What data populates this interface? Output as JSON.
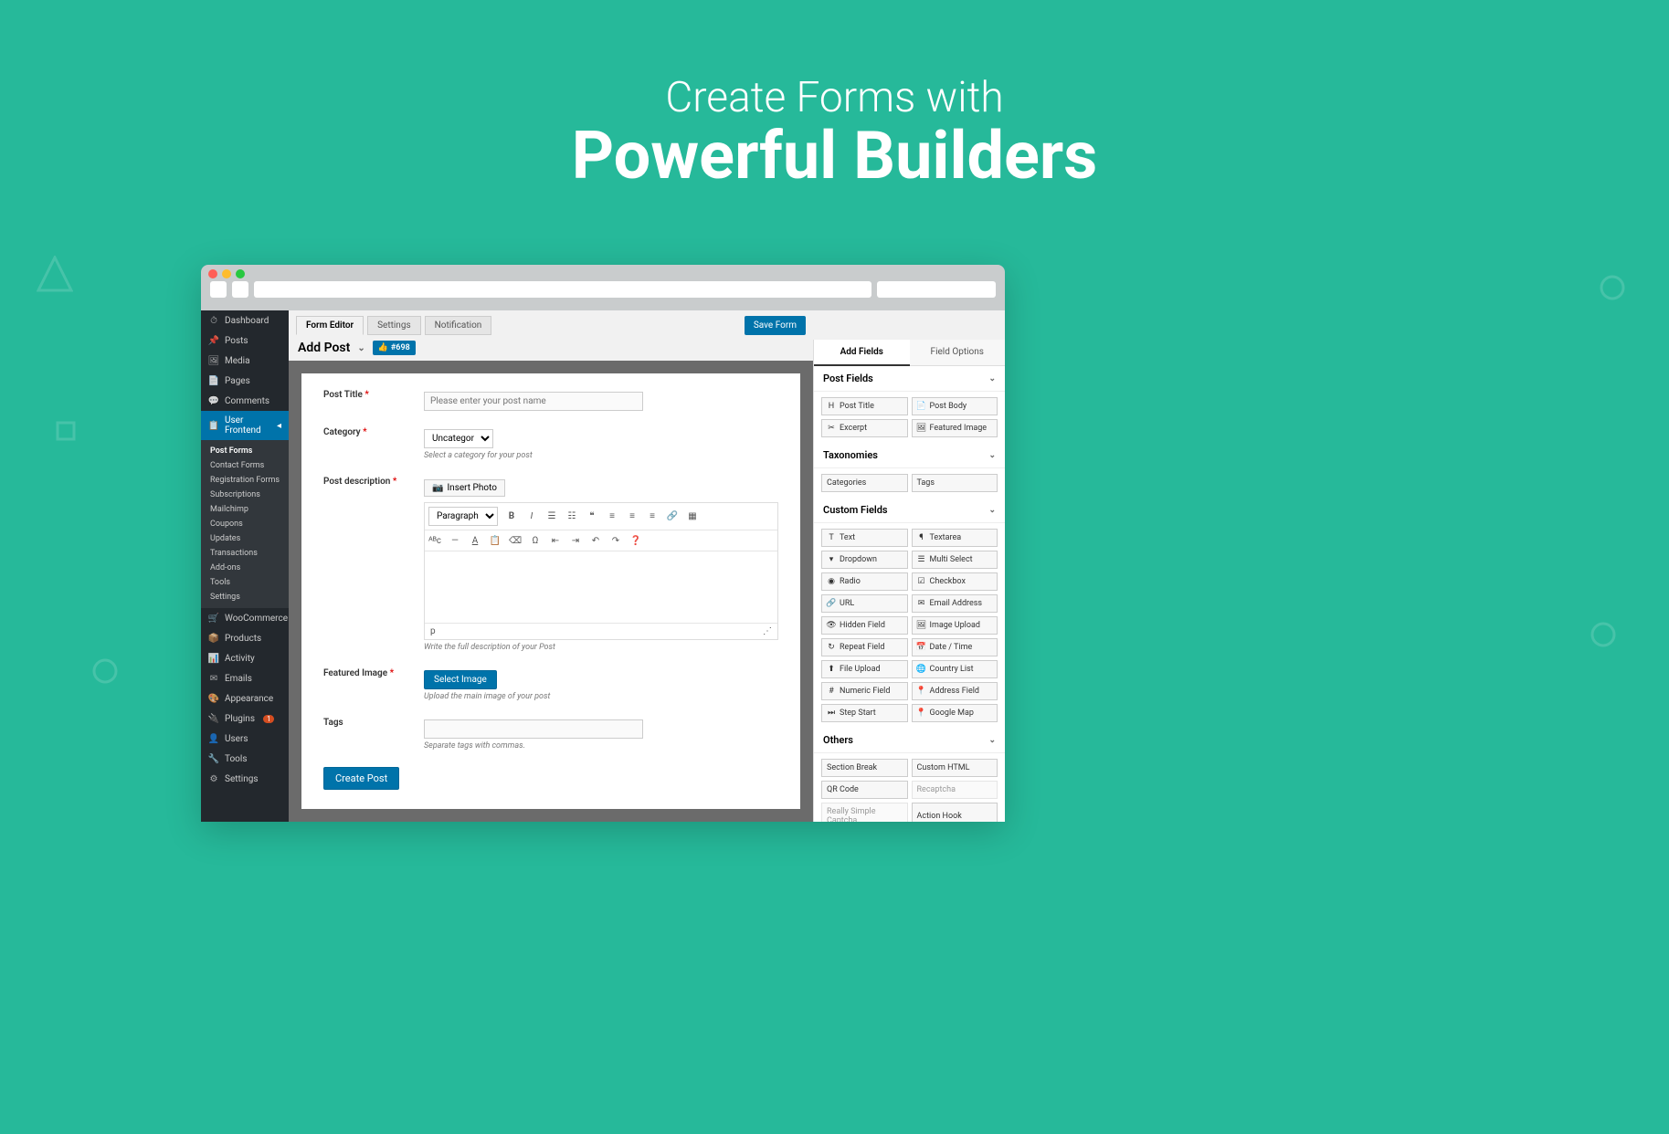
{
  "hero": {
    "line1": "Create Forms with",
    "line2": "Powerful Builders"
  },
  "titlebar": {
    "dots": [
      "#ff5f57",
      "#febc2e",
      "#28c840"
    ]
  },
  "sidebar": {
    "items": [
      {
        "icon": "⏱",
        "label": "Dashboard"
      },
      {
        "icon": "📌",
        "label": "Posts"
      },
      {
        "icon": "🖼",
        "label": "Media"
      },
      {
        "icon": "📄",
        "label": "Pages"
      },
      {
        "icon": "💬",
        "label": "Comments"
      },
      {
        "icon": "📋",
        "label": "User Frontend",
        "active": true
      }
    ],
    "sub": [
      {
        "label": "Post Forms",
        "active": true
      },
      {
        "label": "Contact Forms"
      },
      {
        "label": "Registration Forms"
      },
      {
        "label": "Subscriptions"
      },
      {
        "label": "Mailchimp"
      },
      {
        "label": "Coupons"
      },
      {
        "label": "Updates"
      },
      {
        "label": "Transactions"
      },
      {
        "label": "Add-ons"
      },
      {
        "label": "Tools"
      },
      {
        "label": "Settings"
      }
    ],
    "items2": [
      {
        "icon": "🛒",
        "label": "WooCommerce"
      },
      {
        "icon": "📦",
        "label": "Products"
      },
      {
        "icon": "📊",
        "label": "Activity"
      },
      {
        "icon": "✉",
        "label": "Emails"
      },
      {
        "icon": "🎨",
        "label": "Appearance"
      },
      {
        "icon": "🔌",
        "label": "Plugins",
        "badge": "1"
      },
      {
        "icon": "👤",
        "label": "Users"
      },
      {
        "icon": "🔧",
        "label": "Tools"
      },
      {
        "icon": "⚙",
        "label": "Settings"
      }
    ]
  },
  "tabs": [
    "Form Editor",
    "Settings",
    "Notification"
  ],
  "saveBtn": "Save Form",
  "formTitle": "Add Post",
  "formId": "#698",
  "form": {
    "postTitle": {
      "label": "Post Title",
      "placeholder": "Please enter your post name"
    },
    "category": {
      "label": "Category",
      "value": "Uncategorized",
      "help": "Select a category for your post"
    },
    "desc": {
      "label": "Post description",
      "insert": "Insert Photo",
      "format": "Paragraph",
      "status": "p",
      "help": "Write the full description of your Post"
    },
    "featured": {
      "label": "Featured Image",
      "btn": "Select Image",
      "help": "Upload the main image of your post"
    },
    "tags": {
      "label": "Tags",
      "help": "Separate tags with commas."
    },
    "submit": "Create Post"
  },
  "right": {
    "tabs": [
      "Add Fields",
      "Field Options"
    ],
    "sections": [
      {
        "title": "Post Fields",
        "fields": [
          {
            "icon": "H",
            "label": "Post Title"
          },
          {
            "icon": "📄",
            "label": "Post Body"
          },
          {
            "icon": "✂",
            "label": "Excerpt"
          },
          {
            "icon": "🖼",
            "label": "Featured Image"
          }
        ]
      },
      {
        "title": "Taxonomies",
        "fields": [
          {
            "icon": "",
            "label": "Categories"
          },
          {
            "icon": "",
            "label": "Tags"
          }
        ]
      },
      {
        "title": "Custom Fields",
        "fields": [
          {
            "icon": "T",
            "label": "Text"
          },
          {
            "icon": "¶",
            "label": "Textarea"
          },
          {
            "icon": "▾",
            "label": "Dropdown"
          },
          {
            "icon": "☰",
            "label": "Multi Select"
          },
          {
            "icon": "◉",
            "label": "Radio"
          },
          {
            "icon": "☑",
            "label": "Checkbox"
          },
          {
            "icon": "🔗",
            "label": "URL"
          },
          {
            "icon": "✉",
            "label": "Email Address"
          },
          {
            "icon": "👁",
            "label": "Hidden Field"
          },
          {
            "icon": "🖼",
            "label": "Image Upload"
          },
          {
            "icon": "↻",
            "label": "Repeat Field"
          },
          {
            "icon": "📅",
            "label": "Date / Time"
          },
          {
            "icon": "⬆",
            "label": "File Upload"
          },
          {
            "icon": "🌐",
            "label": "Country List"
          },
          {
            "icon": "#",
            "label": "Numeric Field"
          },
          {
            "icon": "📍",
            "label": "Address Field"
          },
          {
            "icon": "⏭",
            "label": "Step Start"
          },
          {
            "icon": "📍",
            "label": "Google Map"
          }
        ]
      },
      {
        "title": "Others",
        "fields": [
          {
            "icon": "",
            "label": "Section Break"
          },
          {
            "icon": "",
            "label": "Custom HTML"
          },
          {
            "icon": "",
            "label": "QR Code"
          },
          {
            "icon": "",
            "label": "Recaptcha",
            "disabled": true
          },
          {
            "icon": "",
            "label": "Really Simple Captcha",
            "disabled": true
          },
          {
            "icon": "",
            "label": "Action Hook"
          }
        ]
      }
    ]
  }
}
